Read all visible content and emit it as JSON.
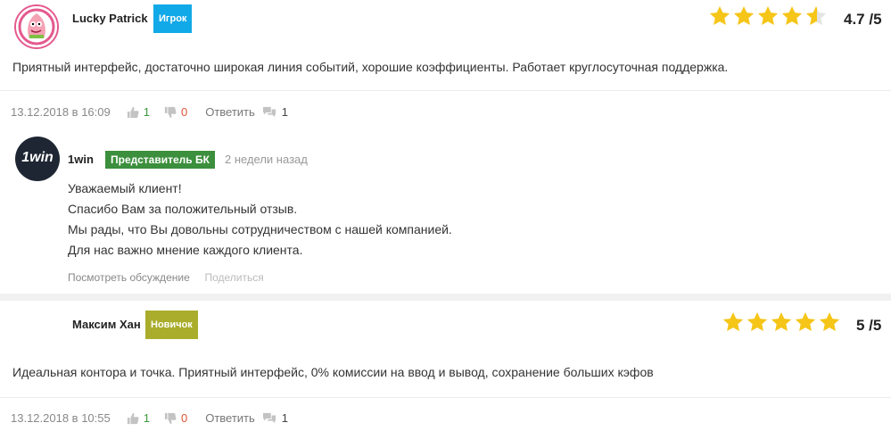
{
  "reviews": [
    {
      "author": "Lucky Patrick",
      "badge": "Игрок",
      "badge_color": "#12a9e8",
      "rating_text": "4.7 /5",
      "rating": 4.7,
      "text": "Приятный интерфейс, достаточно широкая линия событий, хорошие коэффициенты. Работает круглосуточная поддержка.",
      "date": "13.12.2018 в 16:09",
      "likes": "1",
      "dislikes": "0",
      "reply_label": "Ответить",
      "comments": "1"
    },
    {
      "author": "Максим Хан",
      "badge": "Новичок",
      "badge_color": "#a9ad2b",
      "rating_text": "5 /5",
      "rating": 5,
      "text": "Идеальная контора и точка. Приятный интерфейс, 0% комиссии на ввод и вывод, сохранение больших кэфов",
      "date": "13.12.2018 в 10:55",
      "likes": "1",
      "dislikes": "0",
      "reply_label": "Ответить",
      "comments": "1"
    }
  ],
  "reply": {
    "author": "1win",
    "logo_text": "1win",
    "badge": "Представитель БК",
    "badge_color": "#3c8f3c",
    "time": "2 недели назад",
    "lines": [
      "Уважаемый клиент!",
      "Спасибо Вам за положительный отзыв.",
      "Мы рады, что Вы довольны сотрудничеством с нашей компанией.",
      "Для нас важно мнение каждого клиента."
    ],
    "view_discussion": "Посмотреть обсуждение",
    "share": "Поделиться"
  },
  "colors": {
    "star": "#f5c518",
    "star_empty": "#e3e3e3"
  }
}
